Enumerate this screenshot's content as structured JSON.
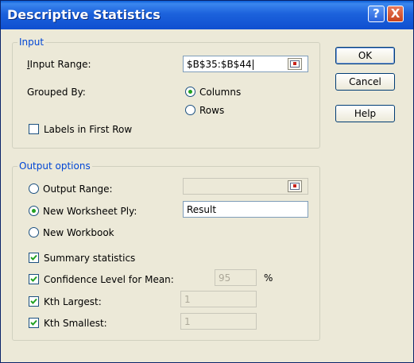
{
  "window": {
    "title": "Descriptive Statistics",
    "help_button": "?",
    "close_button": "X"
  },
  "input_group": {
    "label": "Input",
    "input_range_label": "Input Range:",
    "input_range_value": "$B$35:$B$44",
    "grouped_by_label": "Grouped By:",
    "columns_label": "Columns",
    "rows_label": "Rows",
    "labels_first_row_label": "Labels in First Row",
    "grouped_by_selected": "Columns",
    "labels_first_row_checked": false
  },
  "output_group": {
    "label": "Output options",
    "output_range_label": "Output Range:",
    "output_range_value": "",
    "new_worksheet_label": "New Worksheet Ply:",
    "new_worksheet_value": "Result",
    "new_workbook_label": "New Workbook",
    "selected_option": "New Worksheet Ply",
    "summary_label": "Summary statistics",
    "summary_checked": true,
    "confidence_label": "Confidence Level for Mean:",
    "confidence_checked": true,
    "confidence_value": "95",
    "percent_sign": "%",
    "kth_largest_label": "Kth Largest:",
    "kth_largest_checked": true,
    "kth_largest_value": "1",
    "kth_smallest_label": "Kth Smallest:",
    "kth_smallest_checked": true,
    "kth_smallest_value": "1"
  },
  "buttons": {
    "ok": "OK",
    "cancel": "Cancel",
    "help": "Help"
  },
  "colors": {
    "titlebar": "#0f4fd0",
    "group_label": "#0046d5",
    "dialog_bg": "#ece9d8",
    "radio_dot": "#21a121"
  }
}
